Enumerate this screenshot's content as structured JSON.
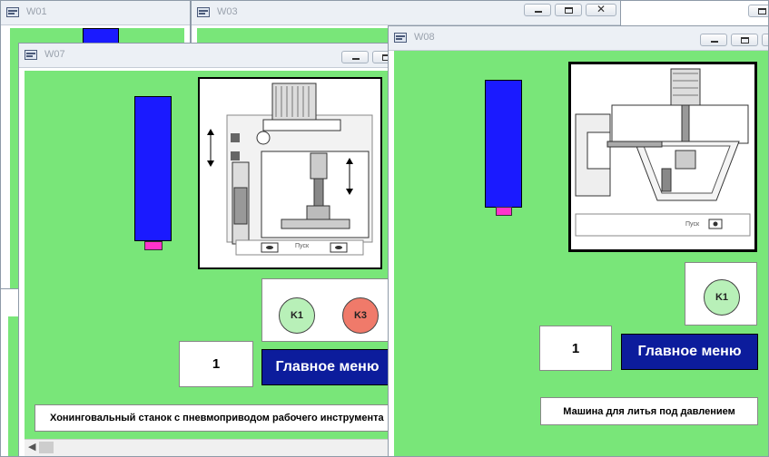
{
  "windows": {
    "w01": {
      "title": "W01"
    },
    "w03": {
      "title": "W03"
    },
    "w07": {
      "title": "W07",
      "lamps": [
        {
          "label": "K1",
          "color": "#b8f0b8"
        },
        {
          "label": "K3",
          "color": "#f07a6a"
        }
      ],
      "counter": "1",
      "main_menu_label": "Главное меню",
      "caption": "Хонинговальный станок с пневмоприводом рабочего инструмента",
      "machine_button_label": "Пуск"
    },
    "w08": {
      "title": "W08",
      "lamps": [
        {
          "label": "K1",
          "color": "#b8f0b8"
        }
      ],
      "counter": "1",
      "main_menu_label": "Главное меню",
      "caption": "Машина для литья под давлением",
      "machine_button_label": "Пуск"
    }
  },
  "colors": {
    "client_bg": "#79e679",
    "bar_blue": "#1a1aff",
    "bar_pink": "#ff33cc",
    "menu_button": "#0c1c9c"
  }
}
